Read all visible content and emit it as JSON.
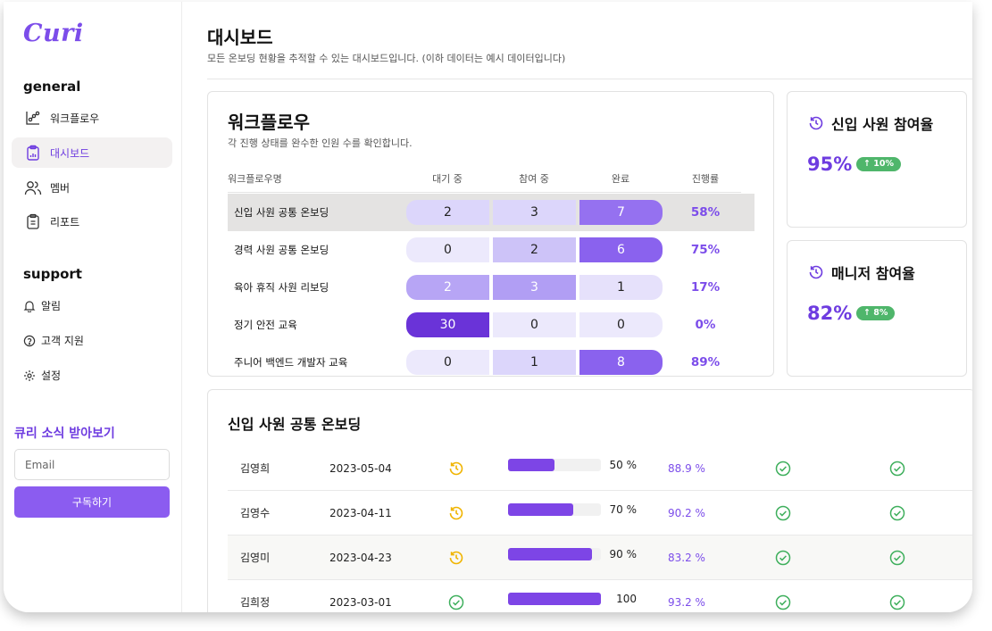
{
  "brand": {
    "logo": "Curi",
    "accent": "#7c4dea"
  },
  "sidebar": {
    "general_title": "general",
    "general_items": [
      {
        "label": "워크플로우",
        "icon": "workflow-icon",
        "active": false
      },
      {
        "label": "대시보드",
        "icon": "clipboard-chart-icon",
        "active": true
      },
      {
        "label": "멤버",
        "icon": "users-icon",
        "active": false
      },
      {
        "label": "리포트",
        "icon": "report-icon",
        "active": false
      }
    ],
    "support_title": "support",
    "support_items": [
      {
        "label": "알림",
        "icon": "bell-icon"
      },
      {
        "label": "고객 지원",
        "icon": "help-circle-icon"
      },
      {
        "label": "설정",
        "icon": "gear-icon"
      }
    ],
    "newsletter_title": "큐리 소식 받아보기",
    "email_placeholder": "Email",
    "subscribe_label": "구독하기"
  },
  "header": {
    "title": "대시보드",
    "subtitle": "모든 온보딩 현황을 추적할 수 있는 대시보드입니다. (이하 데이터는 예시 데이터입니다)"
  },
  "workflow_card": {
    "title": "워크플로우",
    "subtitle": "각 진행 상태를 완수한 인원 수를 확인합니다.",
    "columns": [
      "워크플로우명",
      "대기 중",
      "참여 중",
      "완료",
      "진행률"
    ],
    "rows": [
      {
        "name": "신입 사원 공통 온보딩",
        "waiting": "2",
        "participating": "3",
        "done": "7",
        "progress": "58%"
      },
      {
        "name": "경력 사원 공통 온보딩",
        "waiting": "0",
        "participating": "2",
        "done": "6",
        "progress": "75%"
      },
      {
        "name": "육아 휴직 사원 리보딩",
        "waiting": "2",
        "participating": "3",
        "done": "1",
        "progress": "17%"
      },
      {
        "name": "정기 안전 교육",
        "waiting": "30",
        "participating": "0",
        "done": "0",
        "progress": "0%"
      },
      {
        "name": "주니어 백엔드 개발자 교육",
        "waiting": "0",
        "participating": "1",
        "done": "8",
        "progress": "89%"
      }
    ]
  },
  "stats": [
    {
      "title": "신입 사원 참여율",
      "icon": "history-icon",
      "value": "95%",
      "badge": "↑ 10%"
    },
    {
      "title": "매니저 참여율",
      "icon": "history-icon",
      "value": "82%",
      "badge": "↑ 8%"
    }
  ],
  "detail": {
    "title": "신입 사원 공통 온보딩",
    "rows": [
      {
        "name": "김영희",
        "date": "2023-05-04",
        "status_icon": "clock-pending-icon",
        "progress": 0.5,
        "progress_label": "50 %",
        "score": "88.9 %"
      },
      {
        "name": "김영수",
        "date": "2023-04-11",
        "status_icon": "clock-pending-icon",
        "progress": 0.7,
        "progress_label": "70 %",
        "score": "90.2 %"
      },
      {
        "name": "김영미",
        "date": "2023-04-23",
        "status_icon": "clock-pending-icon",
        "progress": 0.9,
        "progress_label": "90 %",
        "score": "83.2 %"
      },
      {
        "name": "김희정",
        "date": "2023-03-01",
        "status_icon": "check-circle-icon",
        "progress": 1.0,
        "progress_label": "100 %",
        "score": "93.2 %"
      }
    ]
  }
}
